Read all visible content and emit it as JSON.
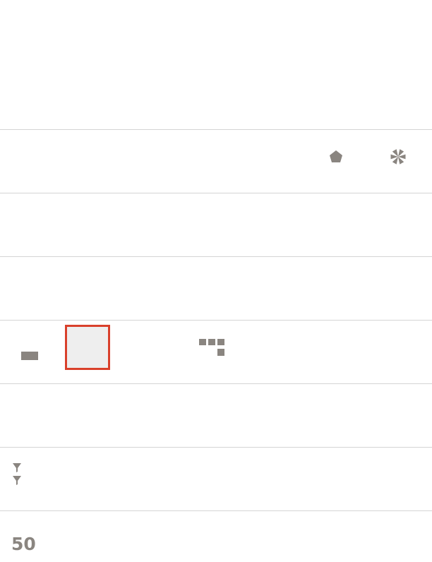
{
  "colors": {
    "icon": "#8a8580",
    "selected_icon": "#7f9f6b",
    "selected_border": "#d9402b",
    "selected_background": "#eeeeee",
    "divider": "#d4d4d4",
    "background": "#ffffff"
  },
  "sections": [
    {
      "id": "bar",
      "rows": [
        [
          "bar-chart-icon",
          "grouped-bar-chart-icon",
          "stacked-bar-chart-icon",
          "horizontal-bar-chart-icon",
          "grouped-horizontal-bar-chart-icon",
          "stacked-horizontal-bar-chart-icon",
          "bar-line-combo-chart-icon"
        ],
        [
          "stacked-bar-line-combo-chart-icon",
          "horizontal-bar-pivot-chart-icon",
          "waterfall-chart-icon",
          "box-plot-icon",
          "horizontal-box-plot-icon"
        ]
      ]
    },
    {
      "id": "area-radar",
      "rows": [
        [
          "line-chart-icon",
          "area-chart-icon",
          "stacked-area-chart-icon",
          "percent-area-chart-icon",
          "radar-line-chart-icon",
          "filled-radar-chart-icon",
          "polar-chart-icon"
        ]
      ]
    },
    {
      "id": "scatter",
      "rows": [
        [
          "scatter-plot-icon",
          "scatter-plot-categories-icon",
          "dot-plot-icon"
        ]
      ]
    },
    {
      "id": "part-to-whole",
      "rows": [
        [
          "pie-chart-icon",
          "donut-chart-icon",
          "sunburst-chart-icon",
          "treemap-icon"
        ]
      ]
    },
    {
      "id": "tables",
      "rows": [
        [
          "table-icon",
          "pivot-table-icon",
          "pivot-tree-icon",
          "tile-grid-icon"
        ]
      ]
    },
    {
      "id": "relationship",
      "rows": [
        [
          "network-graph-icon",
          "chord-diagram-icon",
          "funnel-chart-icon",
          "hierarchy-tree-icon",
          "correlation-chart-icon",
          "parallel-coordinates-icon"
        ]
      ]
    },
    {
      "id": "filters",
      "rows": [
        [
          "list-filter-icon"
        ]
      ]
    },
    {
      "id": "other",
      "rows": [
        [
          "metric-tile-icon",
          "map-pin-icon",
          "text-box-icon",
          "tag-cloud-icon",
          "list-view-icon",
          "diagram-icon"
        ]
      ]
    }
  ],
  "selected": "pivot-table-icon",
  "metric_icon_text": "50"
}
